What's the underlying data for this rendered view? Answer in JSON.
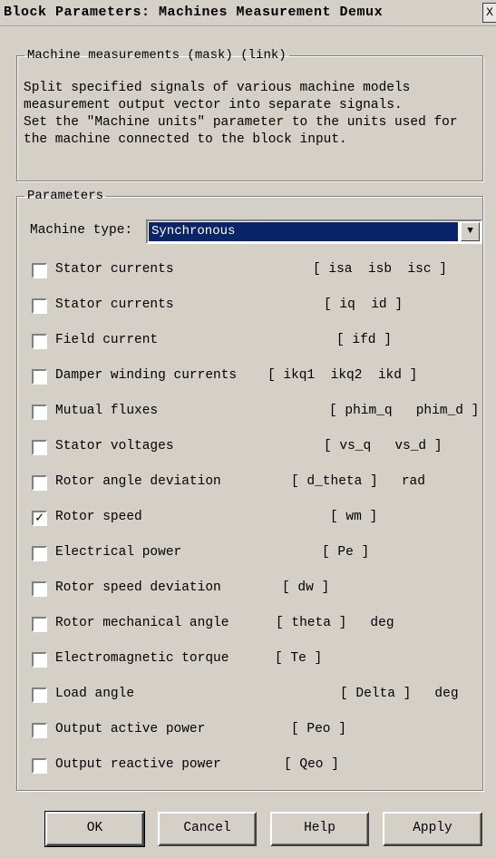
{
  "window": {
    "title": "Block Parameters: Machines Measurement Demux",
    "close_glyph": "X"
  },
  "description": {
    "legend": "Machine measurements (mask) (link)",
    "text": "Split specified signals of various machine models\nmeasurement output vector into separate signals.\nSet the \"Machine units\" parameter to the units used for\nthe machine connected to the block input."
  },
  "parameters": {
    "legend": "Parameters",
    "machine_type_label": "Machine type:",
    "machine_type_value": "Synchronous",
    "rows": [
      {
        "label": "Stator currents",
        "signal": "[ isa  isb  isc ]",
        "checked": false
      },
      {
        "label": "Stator currents",
        "signal": "[ iq  id ]",
        "checked": false
      },
      {
        "label": "Field current",
        "signal": "[ ifd ]",
        "checked": false
      },
      {
        "label": "Damper winding currents",
        "signal": "[ ikq1  ikq2  ikd ]",
        "checked": false
      },
      {
        "label": "Mutual fluxes",
        "signal": "[ phim_q   phim_d ]",
        "checked": false
      },
      {
        "label": "Stator voltages",
        "signal": "[ vs_q   vs_d ]",
        "checked": false
      },
      {
        "label": "Rotor angle deviation",
        "signal": "[ d_theta ]   rad",
        "checked": false
      },
      {
        "label": "Rotor speed",
        "signal": "[ wm ]",
        "checked": true
      },
      {
        "label": "Electrical power",
        "signal": "[ Pe ]",
        "checked": false
      },
      {
        "label": "Rotor speed deviation",
        "signal": "[ dw ]",
        "checked": false
      },
      {
        "label": "Rotor mechanical angle",
        "signal": "[ theta ]   deg",
        "checked": false
      },
      {
        "label": "Electromagnetic torque",
        "signal": "[ Te ]",
        "checked": false
      },
      {
        "label": "Load angle",
        "signal": "[ Delta ]   deg",
        "checked": false
      },
      {
        "label": "Output active power",
        "signal": "[ Peo ]",
        "checked": false
      },
      {
        "label": "Output reactive power",
        "signal": "[ Qeo ]",
        "checked": false
      }
    ]
  },
  "buttons": {
    "ok": "OK",
    "cancel": "Cancel",
    "help": "Help",
    "apply": "Apply"
  },
  "colors": {
    "dialog_bg": "#d4d0c8",
    "selection_bg": "#0a246a",
    "selection_fg": "#ffffff"
  },
  "icons": {
    "close": "close-icon",
    "dropdown": "chevron-down-icon",
    "check": "checkmark-icon"
  }
}
